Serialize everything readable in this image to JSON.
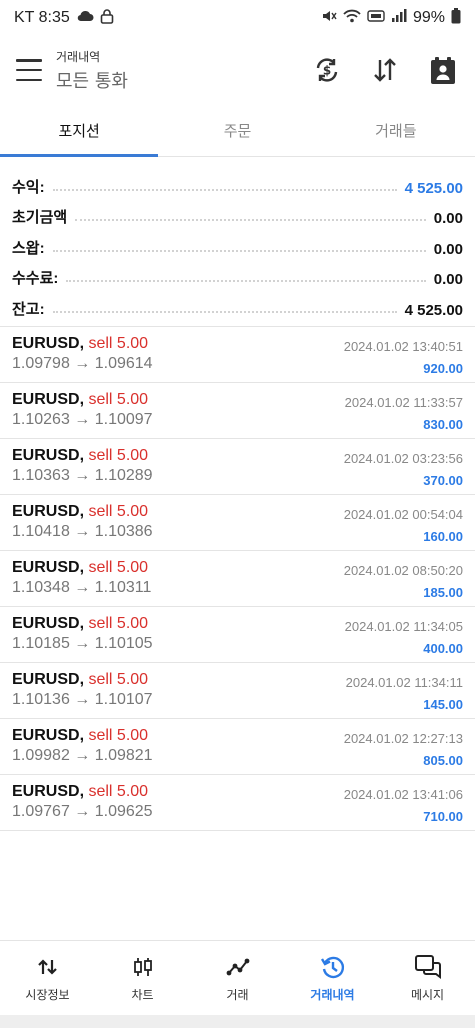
{
  "status_bar": {
    "carrier_time": "KT 8:35",
    "battery": "99%",
    "icons": [
      "weather-cloud-icon",
      "lock-icon",
      "mute-icon",
      "wifi-icon",
      "data-icon",
      "signal-icon",
      "battery-icon"
    ]
  },
  "header": {
    "subtitle": "거래내역",
    "title": "모든 통화",
    "actions": [
      "sync-icon",
      "sort-icon",
      "deposit-icon"
    ]
  },
  "tabs": [
    {
      "label": "포지션",
      "active": true
    },
    {
      "label": "주문",
      "active": false
    },
    {
      "label": "거래들",
      "active": false
    }
  ],
  "summary": [
    {
      "label": "수익:",
      "value": "4 525.00",
      "highlight": true
    },
    {
      "label": "초기금액",
      "value": "0.00",
      "highlight": false
    },
    {
      "label": "스왑:",
      "value": "0.00",
      "highlight": false
    },
    {
      "label": "수수료:",
      "value": "0.00",
      "highlight": false
    },
    {
      "label": "잔고:",
      "value": "4 525.00",
      "highlight": false
    }
  ],
  "deals": [
    {
      "symbol": "EURUSD,",
      "type": "sell 5.00",
      "prices": "1.09798 → 1.09614",
      "time": "2024.01.02 13:40:51",
      "profit": "920.00"
    },
    {
      "symbol": "EURUSD,",
      "type": "sell 5.00",
      "prices": "1.10263 → 1.10097",
      "time": "2024.01.02 11:33:57",
      "profit": "830.00"
    },
    {
      "symbol": "EURUSD,",
      "type": "sell 5.00",
      "prices": "1.10363 → 1.10289",
      "time": "2024.01.02 03:23:56",
      "profit": "370.00"
    },
    {
      "symbol": "EURUSD,",
      "type": "sell 5.00",
      "prices": "1.10418 → 1.10386",
      "time": "2024.01.02 00:54:04",
      "profit": "160.00"
    },
    {
      "symbol": "EURUSD,",
      "type": "sell 5.00",
      "prices": "1.10348 → 1.10311",
      "time": "2024.01.02 08:50:20",
      "profit": "185.00"
    },
    {
      "symbol": "EURUSD,",
      "type": "sell 5.00",
      "prices": "1.10185 → 1.10105",
      "time": "2024.01.02 11:34:05",
      "profit": "400.00"
    },
    {
      "symbol": "EURUSD,",
      "type": "sell 5.00",
      "prices": "1.10136 → 1.10107",
      "time": "2024.01.02 11:34:11",
      "profit": "145.00"
    },
    {
      "symbol": "EURUSD,",
      "type": "sell 5.00",
      "prices": "1.09982 → 1.09821",
      "time": "2024.01.02 12:27:13",
      "profit": "805.00"
    },
    {
      "symbol": "EURUSD,",
      "type": "sell 5.00",
      "prices": "1.09767 → 1.09625",
      "time": "2024.01.02 13:41:06",
      "profit": "710.00"
    }
  ],
  "bottom_nav": [
    {
      "label": "시장정보",
      "icon": "quotes-icon",
      "active": false
    },
    {
      "label": "차트",
      "icon": "candles-icon",
      "active": false
    },
    {
      "label": "거래",
      "icon": "trade-icon",
      "active": false
    },
    {
      "label": "거래내역",
      "icon": "history-icon",
      "active": true
    },
    {
      "label": "메시지",
      "icon": "messages-icon",
      "active": false
    }
  ],
  "colors": {
    "accent": "#2c7be5",
    "sell": "#d9302c",
    "tab_indicator": "#3a7bd5"
  }
}
